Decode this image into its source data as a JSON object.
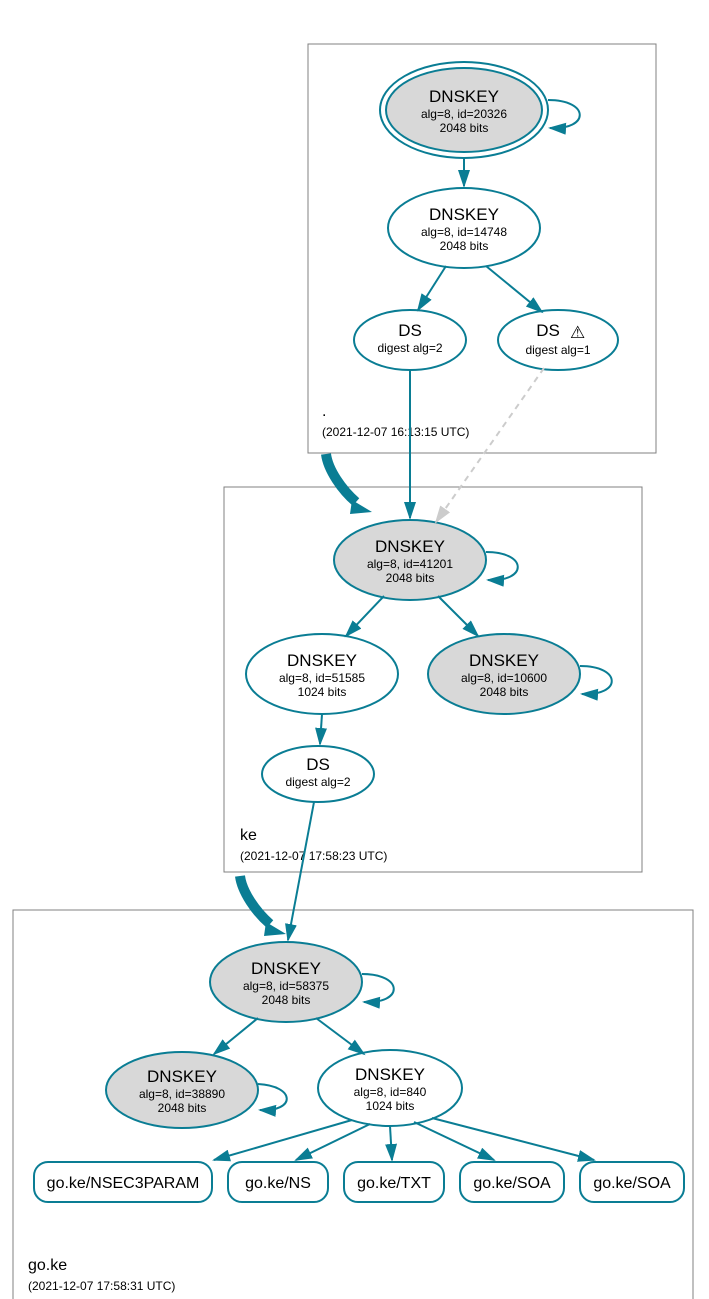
{
  "colors": {
    "stroke": "#0a7d94",
    "node_fill_grey": "#d8d8d8",
    "zone_stroke": "#808080"
  },
  "zones": {
    "root": {
      "name": ".",
      "timestamp": "(2021-12-07 16:13:15 UTC)"
    },
    "ke": {
      "name": "ke",
      "timestamp": "(2021-12-07 17:58:23 UTC)"
    },
    "go_ke": {
      "name": "go.ke",
      "timestamp": "(2021-12-07 17:58:31 UTC)"
    }
  },
  "nodes": {
    "root_ksk": {
      "title": "DNSKEY",
      "line2": "alg=8, id=20326",
      "line3": "2048 bits"
    },
    "root_zsk": {
      "title": "DNSKEY",
      "line2": "alg=8, id=14748",
      "line3": "2048 bits"
    },
    "root_ds1": {
      "title": "DS",
      "line2": "digest alg=2"
    },
    "root_ds2": {
      "title": "DS",
      "line2": "digest alg=1",
      "warn": "⚠"
    },
    "ke_ksk": {
      "title": "DNSKEY",
      "line2": "alg=8, id=41201",
      "line3": "2048 bits"
    },
    "ke_zsk": {
      "title": "DNSKEY",
      "line2": "alg=8, id=51585",
      "line3": "1024 bits"
    },
    "ke_dnskey3": {
      "title": "DNSKEY",
      "line2": "alg=8, id=10600",
      "line3": "2048 bits"
    },
    "ke_ds": {
      "title": "DS",
      "line2": "digest alg=2"
    },
    "goke_ksk": {
      "title": "DNSKEY",
      "line2": "alg=8, id=58375",
      "line3": "2048 bits"
    },
    "goke_dnskey2": {
      "title": "DNSKEY",
      "line2": "alg=8, id=38890",
      "line3": "2048 bits"
    },
    "goke_zsk": {
      "title": "DNSKEY",
      "line2": "alg=8, id=840",
      "line3": "1024 bits"
    }
  },
  "rrsets": {
    "r1": "go.ke/NSEC3PARAM",
    "r2": "go.ke/NS",
    "r3": "go.ke/TXT",
    "r4": "go.ke/SOA",
    "r5": "go.ke/SOA"
  }
}
